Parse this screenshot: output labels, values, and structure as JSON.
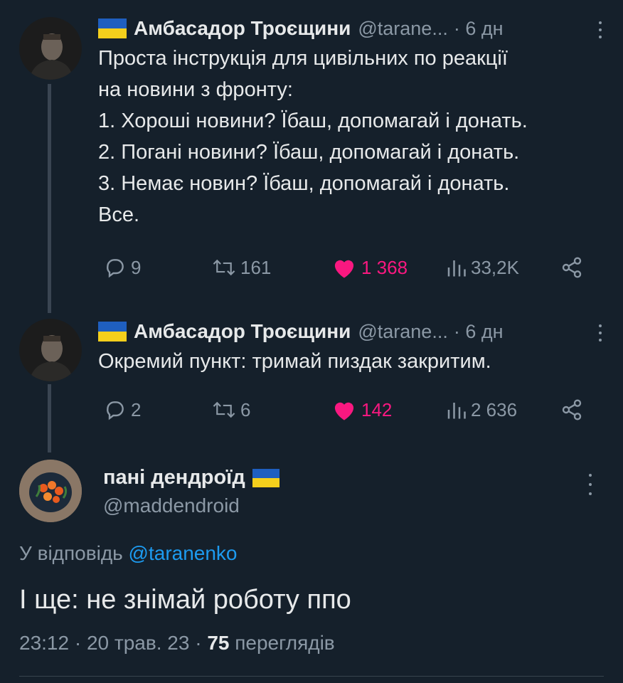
{
  "tweets": [
    {
      "name": "Амбасадор Троєщини",
      "handle": "@tarane...",
      "time": "· 6 дн",
      "text": "Проста інструкція для цивільних по реакції\nна новини з фронту:\n1. Хороші новини? Їбаш, допомагай і донать.\n2. Погані новини? Їбаш, допомагай і донать.\n3. Немає новин? Їбаш, допомагай і донать.\nВсе.",
      "replies": "9",
      "retweets": "161",
      "likes": "1 368",
      "views": "33,2K"
    },
    {
      "name": "Амбасадор Троєщини",
      "handle": "@tarane...",
      "time": "· 6 дн",
      "text": "Окремий пункт: тримай пиздак закритим.",
      "replies": "2",
      "retweets": "6",
      "likes": "142",
      "views": "2 636"
    }
  ],
  "reply": {
    "name": "пані дендроїд",
    "handle": "@maddendroid",
    "replying_prefix": "У відповідь",
    "replying_to": "@taranenko",
    "text": "І ще: не знімай роботу ппо",
    "timestamp": "23:12 · 20 трав. 23 · ",
    "views_count": "75",
    "views_label": " переглядів"
  },
  "colors": {
    "background": "#15202b",
    "text": "#e7e9ea",
    "muted": "#8b98a5",
    "like": "#f91880",
    "link": "#1d9bf0",
    "flag_blue": "#1f5fbf",
    "flag_yellow": "#f4cf1c"
  },
  "icons": [
    "reply-icon",
    "retweet-icon",
    "heart-icon",
    "views-icon",
    "share-icon",
    "more-icon",
    "ukraine-flag-icon"
  ]
}
